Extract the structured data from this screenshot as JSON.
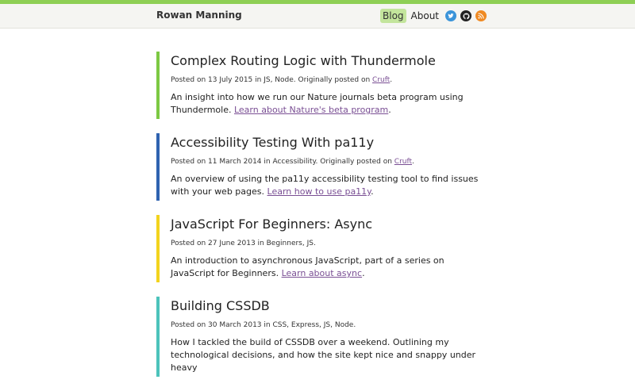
{
  "site": {
    "title": "Rowan Manning",
    "accent_color": "#8ecf55"
  },
  "nav": {
    "blog_label": "Blog",
    "about_label": "About",
    "social_icons": [
      "twitter-icon",
      "github-icon",
      "rss-icon"
    ]
  },
  "posts": [
    {
      "title": "Complex Routing Logic with Thundermole",
      "meta_prefix": "Posted on 13 July 2015 in JS, Node. Originally posted on ",
      "meta_link": "Cruft",
      "meta_suffix": ".",
      "summary_text": "An insight into how we run our Nature journals beta program using Thundermole. ",
      "summary_link": "Learn about Nature's beta program",
      "summary_suffix": ".",
      "bar_color": "#7cc943"
    },
    {
      "title": "Accessibility Testing With pa11y",
      "meta_prefix": "Posted on 11 March 2014 in Accessibility. Originally posted on ",
      "meta_link": "Cruft",
      "meta_suffix": ".",
      "summary_text": "An overview of using the pa11y accessibility testing tool to find issues with your web pages. ",
      "summary_link": "Learn how to use pa11y",
      "summary_suffix": ".",
      "bar_color": "#2f63b0"
    },
    {
      "title": "JavaScript For Beginners: Async",
      "meta_prefix": "Posted on 27 June 2013 in Beginners, JS.",
      "summary_text": "An introduction to asynchronous JavaScript, part of a series on JavaScript for Beginners. ",
      "summary_link": "Learn about async",
      "summary_suffix": ".",
      "bar_color": "#f3d31e"
    },
    {
      "title": "Building CSSDB",
      "meta_prefix": "Posted on 30 March 2013 in CSS, Express, JS, Node.",
      "summary_text": "How I tackled the build of CSSDB over a weekend. Outlining my technological decisions, and how the site kept nice and snappy under heavy",
      "bar_color": "#4cc3bb"
    }
  ]
}
